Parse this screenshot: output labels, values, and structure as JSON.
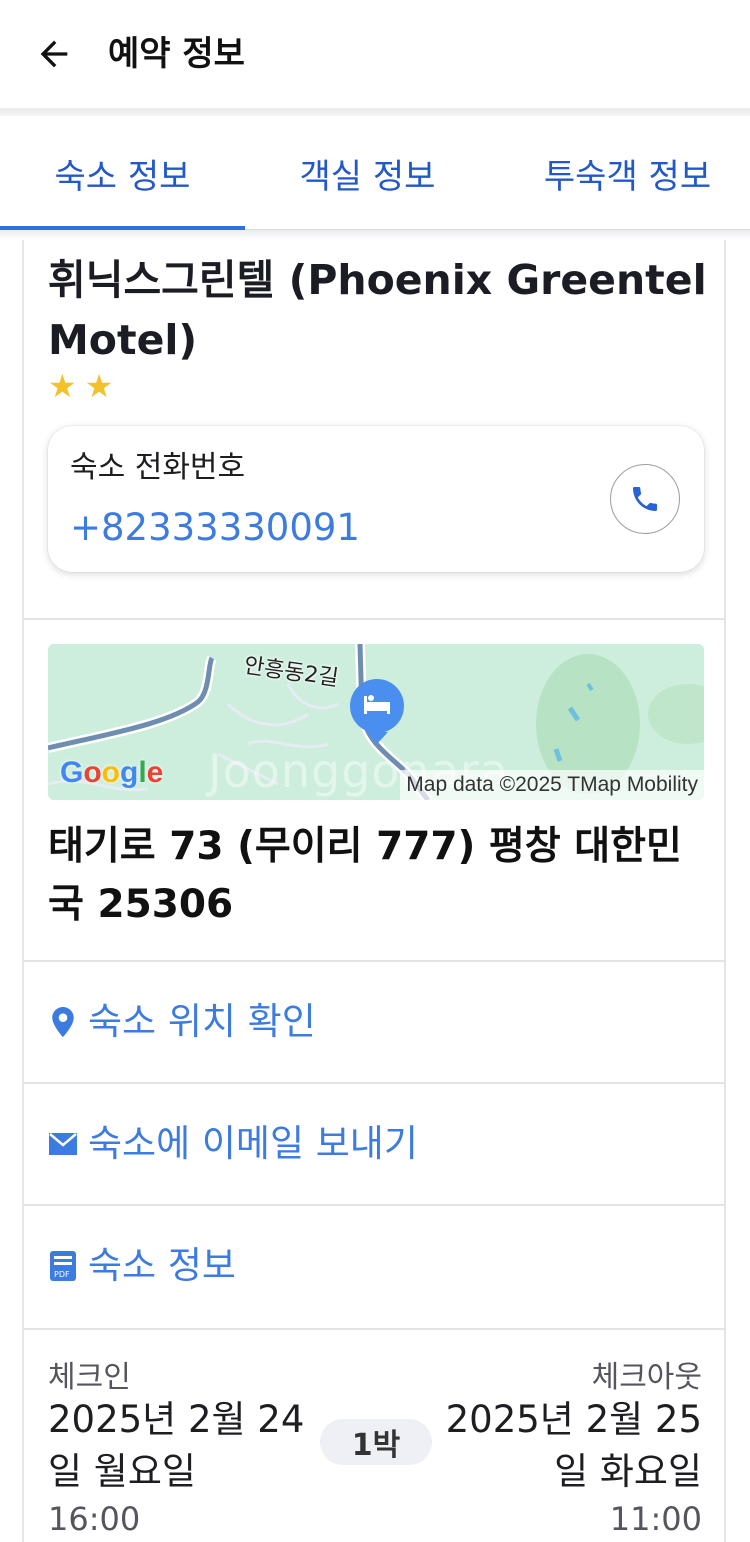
{
  "appbar": {
    "title": "예약 정보",
    "back_icon": "arrow-left-icon"
  },
  "tabs": [
    {
      "label": "숙소 정보",
      "active": true
    },
    {
      "label": "객실 정보",
      "active": false
    },
    {
      "label": "투숙객 정보",
      "active": false
    }
  ],
  "hotel": {
    "name": "휘닉스그린텔 (Phoenix Greentel Motel)",
    "star_rating": 2
  },
  "phone": {
    "label": "숙소 전화번호",
    "number": "+82333330091",
    "icon": "phone-icon"
  },
  "map": {
    "street_label": "안흥동2길",
    "provider": "Google",
    "attribution": "Map data ©2025 TMap Mobility",
    "watermark": "Joonggonara",
    "pin_icon": "bed-icon"
  },
  "address": "태기로 73 (무이리 777) 평창 대한민국 25306",
  "actions": [
    {
      "label": "숙소 위치 확인",
      "icon": "location-pin-icon"
    },
    {
      "label": "숙소에 이메일 보내기",
      "icon": "envelope-icon"
    },
    {
      "label": "숙소 정보",
      "icon": "pdf-document-icon"
    }
  ],
  "stay": {
    "checkin_label": "체크인",
    "checkin_date": "2025년 2월 24일 월요일",
    "checkin_time": "16:00",
    "checkout_label": "체크아웃",
    "checkout_date": "2025년 2월 25일 화요일",
    "checkout_time": "11:00",
    "nights": "1박"
  },
  "colors": {
    "accent_blue": "#3c7be0",
    "tab_blue": "#2358c9",
    "star": "#f3c22b"
  }
}
